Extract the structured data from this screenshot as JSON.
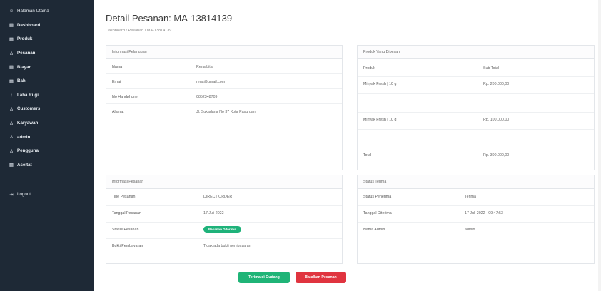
{
  "sidebar": {
    "items": [
      {
        "icon": "user-circle-icon",
        "glyph": "☺",
        "label": "Halaman Utama"
      },
      {
        "icon": "dashboard-icon",
        "glyph": "▦",
        "label": "Dashboard"
      },
      {
        "icon": "grid-icon",
        "glyph": "▦",
        "label": "Produk"
      },
      {
        "icon": "users-icon",
        "glyph": "♙",
        "label": "Pesanan"
      },
      {
        "icon": "grid-icon",
        "glyph": "▦",
        "label": "Biayan"
      },
      {
        "icon": "grid-icon",
        "glyph": "▦",
        "label": "Bah"
      },
      {
        "icon": "chart-icon",
        "glyph": "↕",
        "label": "Laba Rugi"
      },
      {
        "icon": "users-icon",
        "glyph": "♙",
        "label": "Customers"
      },
      {
        "icon": "user-icon",
        "glyph": "♙",
        "label": "Karyawan"
      },
      {
        "icon": "users-icon",
        "glyph": "♙",
        "label": "admin"
      },
      {
        "icon": "users-icon",
        "glyph": "♙",
        "label": "Pengguna"
      },
      {
        "icon": "grid-icon",
        "glyph": "▦",
        "label": "Aseitat"
      }
    ],
    "logout": {
      "icon": "logout-icon",
      "glyph": "⇥",
      "label": "Logout"
    }
  },
  "header": {
    "title": "Detail Pesanan: MA-13814139",
    "breadcrumb": "Dashboard / Pesanan / MA-13814139"
  },
  "info_pelanggan": {
    "title": "Informasi Pelanggan",
    "rows": [
      {
        "key": "Nama",
        "value": "Rena Lita"
      },
      {
        "key": "Email",
        "value": "rena@gmail.com"
      },
      {
        "key": "No Handphone",
        "value": "0852348709"
      },
      {
        "key": "Alamat",
        "value": "Jl. Sukadana No 37 Kota Pasuruan"
      }
    ]
  },
  "produk_dipesan": {
    "title": "Produk Yang Dipesan",
    "col_product": "Produk",
    "col_subtotal": "Sub Total",
    "rows": [
      {
        "product": "Minyak Fresh | 10 g",
        "subtotal": "Rp. 200.000,00"
      },
      {
        "product": "",
        "subtotal": ""
      },
      {
        "product": "Minyak Fresh | 10 g",
        "subtotal": "Rp. 100.000,00"
      },
      {
        "product": "",
        "subtotal": ""
      }
    ],
    "total_label": "Total",
    "total_value": "Rp. 300.000,00"
  },
  "info_pesanan": {
    "title": "Informasi Pesanan",
    "rows": [
      {
        "key": "Tipe Pesanan",
        "value": "DIRECT ORDER"
      },
      {
        "key": "Tanggal Pesanan",
        "value": "17 Juli 2022"
      },
      {
        "key": "Status Pesanan",
        "badge": "Pesanan Diterima"
      },
      {
        "key": "Bukti Pembayaran",
        "value": "Tidak ada bukti pembayaran"
      }
    ]
  },
  "status_terima": {
    "title": "Status Terima",
    "rows": [
      {
        "key": "Status Penerima",
        "value": "Terima"
      },
      {
        "key": "Tanggal Diterima",
        "value": "17 Juli 2022 - 09:47:53"
      },
      {
        "key": "Nama Admin",
        "value": "admin"
      }
    ]
  },
  "actions": {
    "primary": "Terima di Gudang",
    "danger": "Batalkan Pesanan"
  },
  "colors": {
    "sidebar": "#1e2936",
    "success": "#1fb477",
    "danger": "#e0343f"
  }
}
